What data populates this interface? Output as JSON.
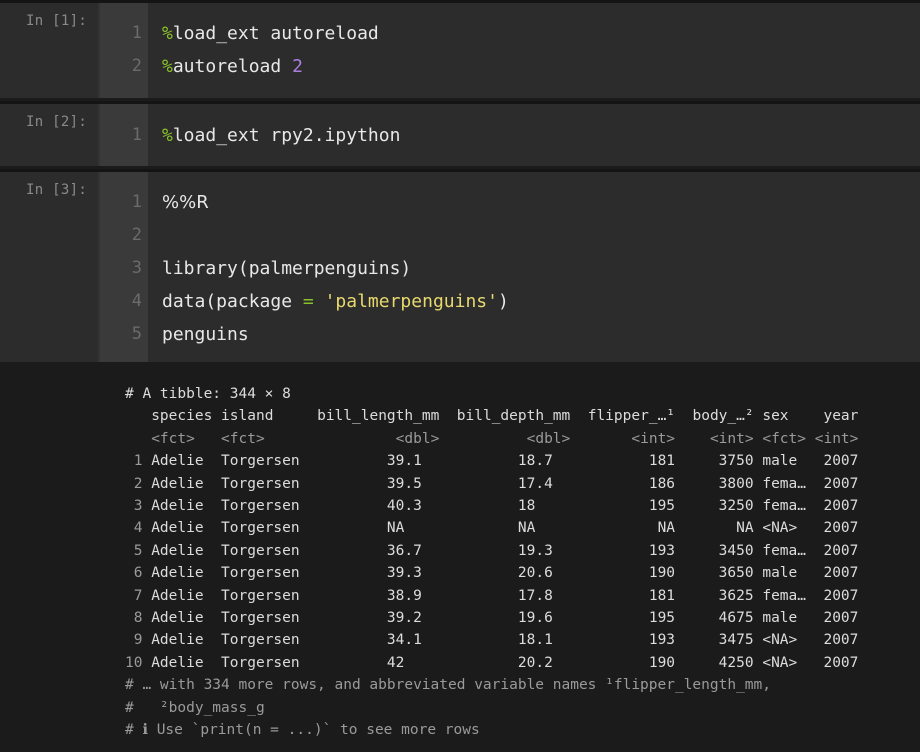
{
  "cells": [
    {
      "prompt": "In [1]:",
      "lines": [
        {
          "num": "1",
          "parts": [
            {
              "t": "%",
              "c": "green"
            },
            {
              "t": "load_ext autoreload",
              "c": ""
            }
          ]
        },
        {
          "num": "2",
          "parts": [
            {
              "t": "%",
              "c": "green"
            },
            {
              "t": "autoreload ",
              "c": ""
            },
            {
              "t": "2",
              "c": "purple"
            }
          ]
        }
      ]
    },
    {
      "prompt": "In [2]:",
      "lines": [
        {
          "num": "1",
          "parts": [
            {
              "t": "%",
              "c": "green"
            },
            {
              "t": "load_ext rpy2.ipython",
              "c": ""
            }
          ]
        }
      ]
    },
    {
      "prompt": "In [3]:",
      "lines": [
        {
          "num": "1",
          "parts": [
            {
              "t": "%%R",
              "c": "plain-font"
            }
          ]
        },
        {
          "num": "2",
          "parts": []
        },
        {
          "num": "3",
          "parts": [
            {
              "t": "library(palmerpenguins)",
              "c": ""
            }
          ]
        },
        {
          "num": "4",
          "parts": [
            {
              "t": "data(package ",
              "c": ""
            },
            {
              "t": "=",
              "c": "green"
            },
            {
              "t": " ",
              "c": ""
            },
            {
              "t": "'palmerpenguins'",
              "c": "yellow"
            },
            {
              "t": ")",
              "c": ""
            }
          ]
        },
        {
          "num": "5",
          "parts": [
            {
              "t": "penguins",
              "c": ""
            }
          ]
        }
      ]
    }
  ],
  "output": {
    "header": "# A tibble: 344 × 8",
    "columns": [
      "species",
      "island",
      "bill_length_mm",
      "bill_depth_mm",
      "flipper_…¹",
      "body_…²",
      "sex",
      "year"
    ],
    "types": [
      "<fct>",
      "<fct>",
      "<dbl>",
      "<dbl>",
      "<int>",
      "<int>",
      "<fct>",
      "<int>"
    ],
    "rows": [
      [
        "1",
        "Adelie",
        "Torgersen",
        "39.1",
        "18.7",
        "181",
        "3750",
        "male",
        "2007"
      ],
      [
        "2",
        "Adelie",
        "Torgersen",
        "39.5",
        "17.4",
        "186",
        "3800",
        "fema…",
        "2007"
      ],
      [
        "3",
        "Adelie",
        "Torgersen",
        "40.3",
        "18",
        "195",
        "3250",
        "fema…",
        "2007"
      ],
      [
        "4",
        "Adelie",
        "Torgersen",
        "NA",
        "NA",
        "NA",
        "NA",
        "<NA>",
        "2007"
      ],
      [
        "5",
        "Adelie",
        "Torgersen",
        "36.7",
        "19.3",
        "193",
        "3450",
        "fema…",
        "2007"
      ],
      [
        "6",
        "Adelie",
        "Torgersen",
        "39.3",
        "20.6",
        "190",
        "3650",
        "male",
        "2007"
      ],
      [
        "7",
        "Adelie",
        "Torgersen",
        "38.9",
        "17.8",
        "181",
        "3625",
        "fema…",
        "2007"
      ],
      [
        "8",
        "Adelie",
        "Torgersen",
        "39.2",
        "19.6",
        "195",
        "4675",
        "male",
        "2007"
      ],
      [
        "9",
        "Adelie",
        "Torgersen",
        "34.1",
        "18.1",
        "193",
        "3475",
        "<NA>",
        "2007"
      ],
      [
        "10",
        "Adelie",
        "Torgersen",
        "42",
        "20.2",
        "190",
        "4250",
        "<NA>",
        "2007"
      ]
    ],
    "footer": [
      "# … with 334 more rows, and abbreviated variable names ¹flipper_length_mm,",
      "#   ²body_mass_g",
      "# ℹ Use `print(n = ...)` to see more rows"
    ]
  },
  "colors": {
    "green": "#8ac22b",
    "purple": "#ab7fe0",
    "yellow": "#e7d96d"
  }
}
